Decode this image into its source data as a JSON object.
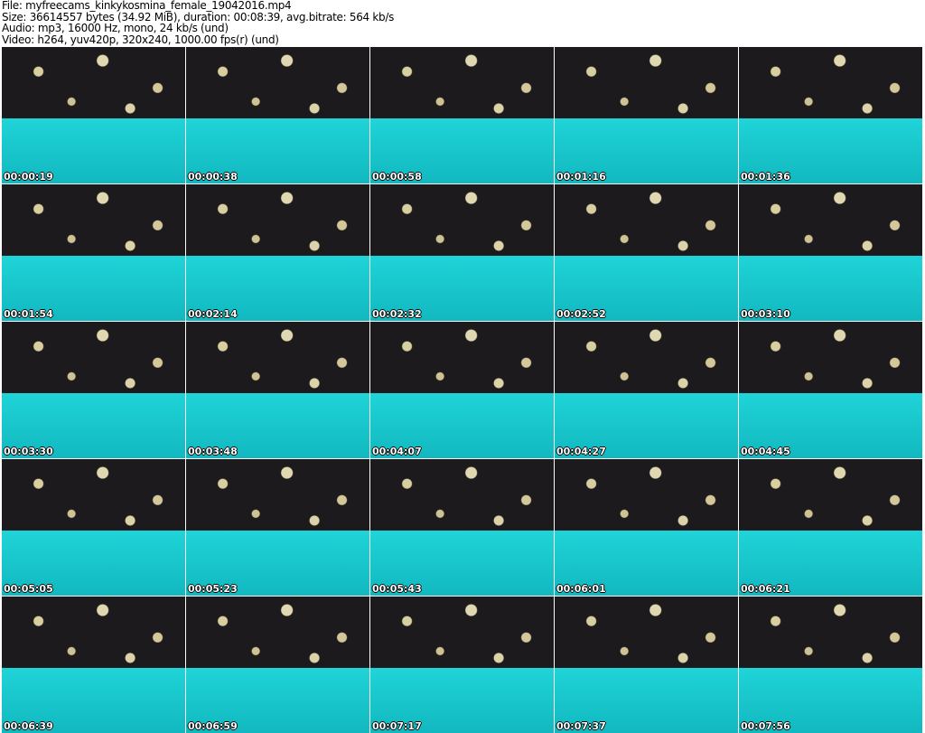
{
  "header": {
    "file": "File: myfreecams_kinkykosmina_female_19042016.mp4",
    "size": "Size: 36614557 bytes (34.92 MiB), duration: 00:08:39, avg.bitrate: 564 kb/s",
    "audio": "Audio: mp3, 16000 Hz, mono, 24 kb/s (und)",
    "video": "Video: h264, yuv420p, 320x240, 1000.00 fps(r) (und)"
  },
  "thumbnails": [
    "00:00:19",
    "00:00:38",
    "00:00:58",
    "00:01:16",
    "00:01:36",
    "00:01:54",
    "00:02:14",
    "00:02:32",
    "00:02:52",
    "00:03:10",
    "00:03:30",
    "00:03:48",
    "00:04:07",
    "00:04:27",
    "00:04:45",
    "00:05:05",
    "00:05:23",
    "00:05:43",
    "00:06:01",
    "00:06:21",
    "00:06:39",
    "00:06:59",
    "00:07:17",
    "00:07:37",
    "00:07:56"
  ]
}
